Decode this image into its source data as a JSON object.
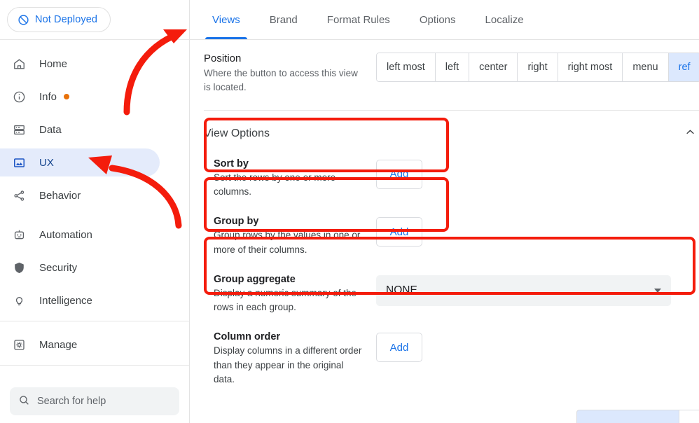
{
  "sidebar": {
    "deploy_status": {
      "label": "Not Deployed",
      "icon": "circle-slash-icon",
      "color": "#1a73e8"
    },
    "nav_items": [
      {
        "label": "Home",
        "icon": "home-icon",
        "selected": false,
        "badge": false
      },
      {
        "label": "Info",
        "icon": "info-circle-icon",
        "selected": false,
        "badge": true
      },
      {
        "label": "Data",
        "icon": "database-icon",
        "selected": false,
        "badge": false
      },
      {
        "label": "UX",
        "icon": "image-icon",
        "selected": true,
        "badge": false
      },
      {
        "label": "Behavior",
        "icon": "share-nodes-icon",
        "selected": false,
        "badge": false
      },
      {
        "label": "Automation",
        "icon": "robot-icon",
        "selected": false,
        "badge": false
      },
      {
        "label": "Security",
        "icon": "shield-icon",
        "selected": false,
        "badge": false
      },
      {
        "label": "Intelligence",
        "icon": "lightbulb-icon",
        "selected": false,
        "badge": false
      }
    ],
    "manage_item": {
      "label": "Manage",
      "icon": "settings-box-icon"
    },
    "search": {
      "placeholder": "Search for help",
      "icon": "search-icon"
    }
  },
  "tabs": [
    {
      "label": "Views",
      "active": true
    },
    {
      "label": "Brand",
      "active": false
    },
    {
      "label": "Format Rules",
      "active": false
    },
    {
      "label": "Options",
      "active": false
    },
    {
      "label": "Localize",
      "active": false
    }
  ],
  "position": {
    "title": "Position",
    "description": "Where the button to access this view is located.",
    "options": [
      "left most",
      "left",
      "center",
      "right",
      "right most",
      "menu",
      "ref"
    ],
    "selected": "ref"
  },
  "view_options": {
    "title": "View Options",
    "collapse_icon": "chevron-up-icon",
    "rows": [
      {
        "title": "Sort by",
        "description": "Sort the rows by one or more columns.",
        "control": "button",
        "button_label": "Add",
        "highlighted": true
      },
      {
        "title": "Group by",
        "description": "Group rows by the values in one or more of their columns.",
        "control": "button",
        "button_label": "Add",
        "highlighted": true
      },
      {
        "title": "Group aggregate",
        "description": "Display a numeric summary of the rows in each group.",
        "control": "select",
        "select_value": "NONE",
        "highlighted": true
      },
      {
        "title": "Column order",
        "description": "Display columns in a different order than they appear in the original data.",
        "control": "button",
        "button_label": "Add",
        "highlighted": false
      }
    ]
  },
  "annotations": {
    "highlight_color": "#f41c0c",
    "arrows": [
      {
        "name": "arrow-to-views-tab",
        "target": "Views tab"
      },
      {
        "name": "arrow-to-ux-nav",
        "target": "UX sidebar item"
      }
    ]
  }
}
